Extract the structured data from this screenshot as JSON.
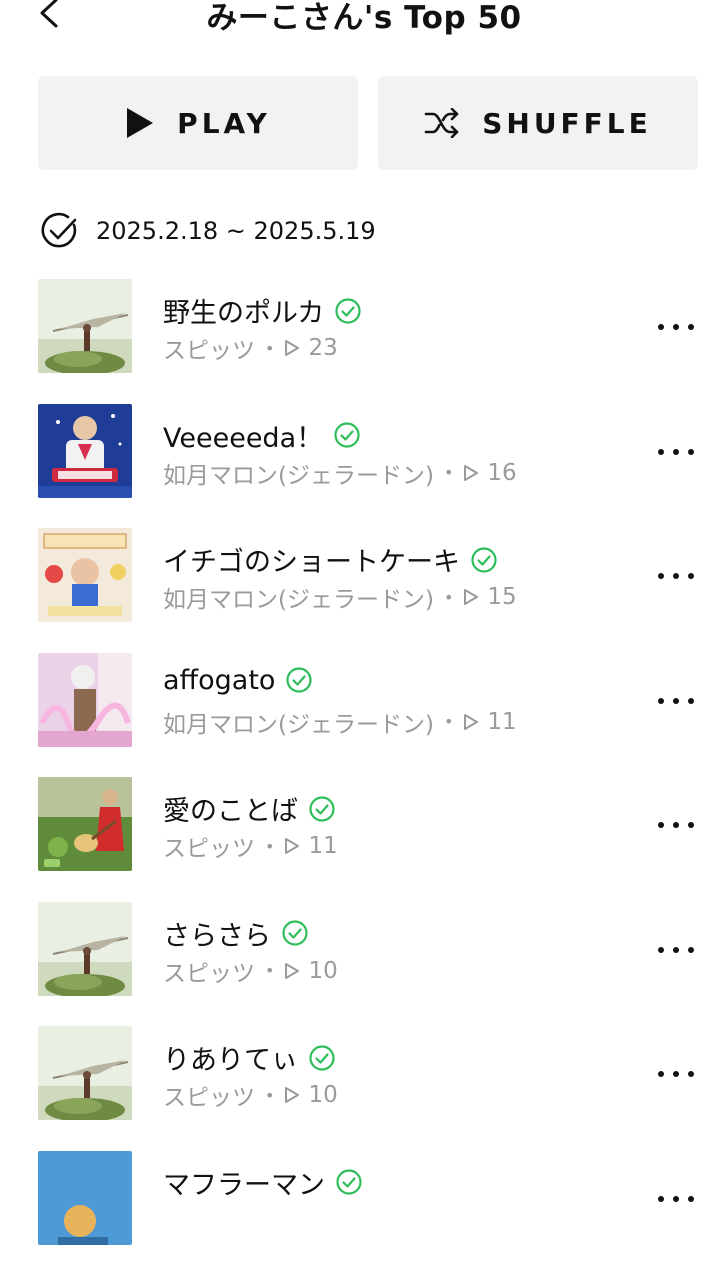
{
  "header": {
    "title": "みーこさん's Top 50"
  },
  "actions": {
    "play_label": "PLAY",
    "shuffle_label": "SHUFFLE"
  },
  "range": {
    "text": "2025.2.18 ~ 2025.5.19"
  },
  "colors": {
    "accent": "#2ebd59",
    "button_bg": "#f2f2f2",
    "muted": "#9a9a9a"
  },
  "tracks": [
    {
      "title": "野生のポルカ",
      "artist": "スピッツ",
      "plays": "23",
      "art": "plane"
    },
    {
      "title": "Veeeeeda！",
      "artist": "如月マロン(ジェラードン)",
      "plays": "16",
      "art": "veeeda"
    },
    {
      "title": "イチゴのショートケーキ",
      "artist": "如月マロン(ジェラードン)",
      "plays": "15",
      "art": "cake"
    },
    {
      "title": "affogato",
      "artist": "如月マロン(ジェラードン)",
      "plays": "11",
      "art": "pink"
    },
    {
      "title": "愛のことば",
      "artist": "スピッツ",
      "plays": "11",
      "art": "guitar"
    },
    {
      "title": "さらさら",
      "artist": "スピッツ",
      "plays": "10",
      "art": "plane"
    },
    {
      "title": "りありてぃ",
      "artist": "スピッツ",
      "plays": "10",
      "art": "plane"
    },
    {
      "title": "マフラーマン",
      "artist": "",
      "plays": "",
      "art": "blue"
    }
  ]
}
